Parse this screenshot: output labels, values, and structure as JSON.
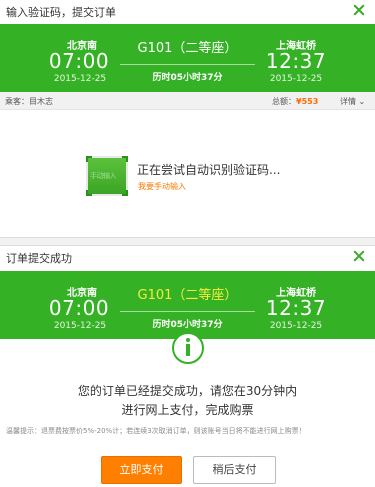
{
  "panel1": {
    "title": "输入验证码，提交订单",
    "train": {
      "from_station": "北京南",
      "from_time": "07:00",
      "from_date": "2015-12-25",
      "train_no": "G101（二等座）",
      "duration": "历时05小时37分",
      "to_station": "上海虹桥",
      "to_time": "12:37",
      "to_date": "2015-12-25"
    },
    "passenger_label": "乘客：目木志",
    "total_label": "总额：",
    "total_amount": "¥553",
    "detail_label": "详情",
    "captcha_text": "正在尝试自动识别验证码...",
    "manual_link": "我要手动输入",
    "captcha_image_text": "手动输入"
  },
  "panel2": {
    "title": "订单提交成功",
    "train": {
      "from_station": "北京南",
      "from_time": "07:00",
      "from_date": "2015-12-25",
      "train_no": "G101（二等座）",
      "duration": "历时05小时37分",
      "to_station": "上海虹桥",
      "to_time": "12:37",
      "to_date": "2015-12-25"
    },
    "message_line1": "您的订单已经提交成功，请您在30分钟内",
    "message_line2": "进行网上支付，完成购票",
    "tip": "温馨提示：退票费按票价5%-20%计；若连续3次取消订单，则该账号当日将不能进行网上购票！",
    "pay_button": "立即支付",
    "later_button": "稍后支付"
  },
  "colors": {
    "green": "#35b125",
    "orange": "#ff7f00",
    "yellow": "#f6ef3a"
  }
}
